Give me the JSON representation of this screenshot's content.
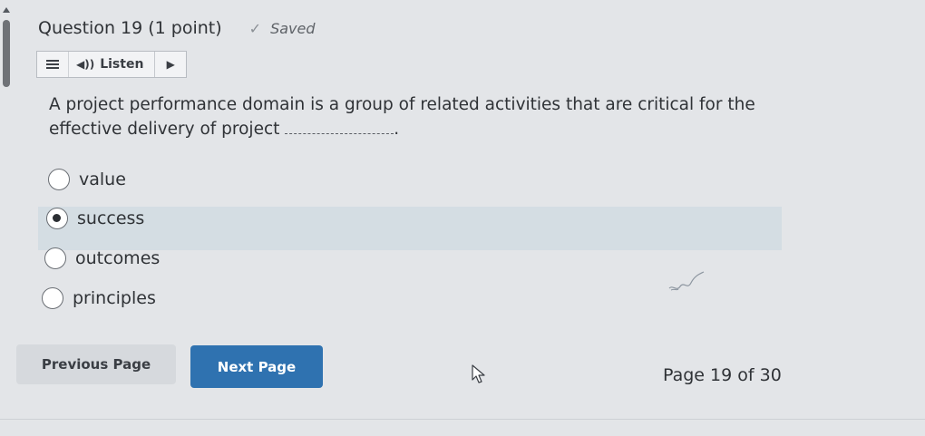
{
  "question": {
    "title": "Question 19",
    "points": "(1 point)",
    "saved_label": "Saved",
    "text_before_blank": "A project performance domain is a group of related activities that are critical for the effective delivery of project",
    "text_after_blank": "."
  },
  "listen_toolbar": {
    "menu_icon": "hamburger-menu-icon",
    "listen_label": "Listen",
    "speaker_icon": "speaker-icon",
    "play_icon": "play-icon"
  },
  "options": [
    {
      "label": "value",
      "selected": false
    },
    {
      "label": "success",
      "selected": true
    },
    {
      "label": "outcomes",
      "selected": false
    },
    {
      "label": "principles",
      "selected": false
    }
  ],
  "navigation": {
    "previous_label": "Previous Page",
    "next_label": "Next Page",
    "page_indicator": "Page 19 of 30"
  },
  "colors": {
    "background": "#e3e5e8",
    "next_button": "#2f72b0",
    "selected_row": "#d4dde3",
    "text": "#2f3236"
  }
}
